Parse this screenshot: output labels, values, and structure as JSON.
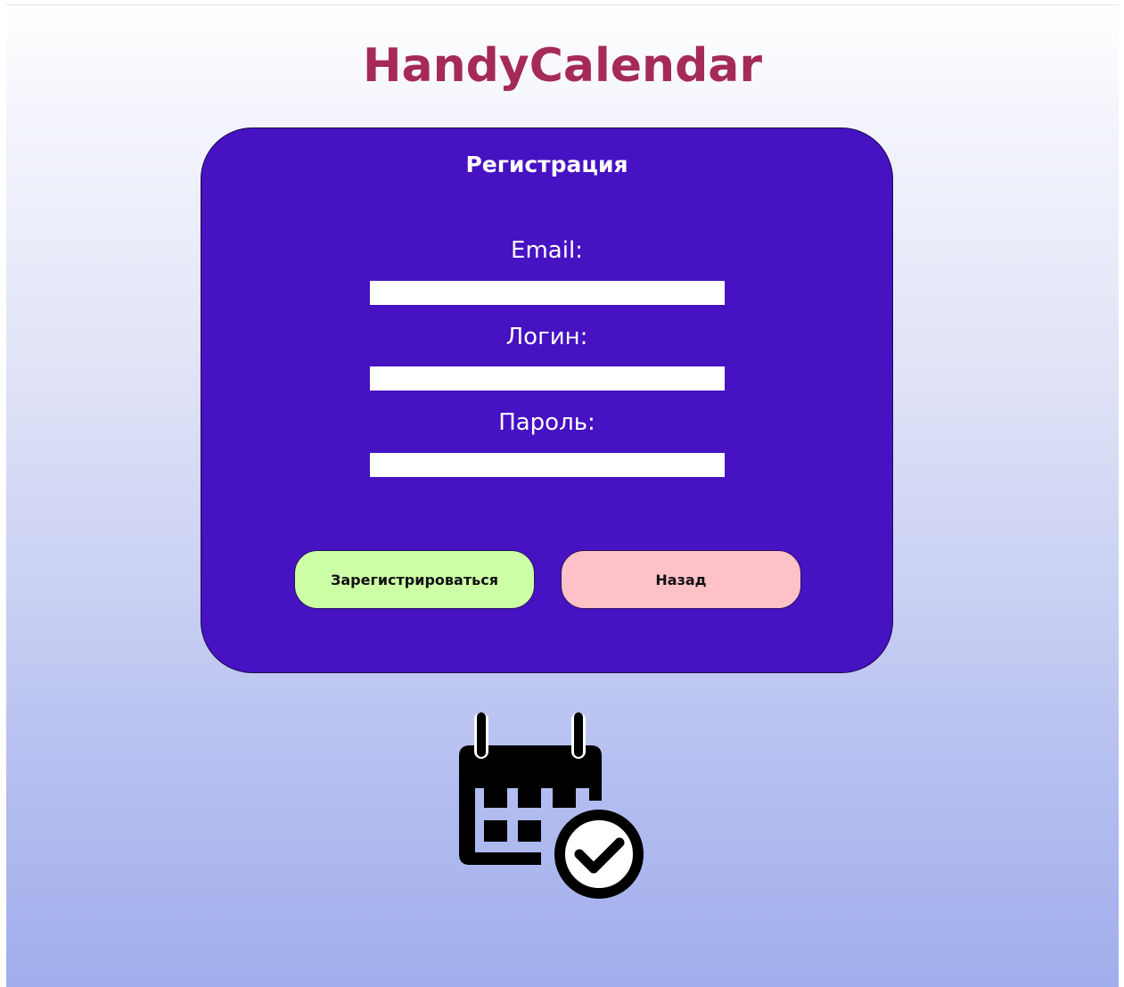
{
  "app": {
    "title": "HandyCalendar"
  },
  "form": {
    "title": "Регистрация",
    "fields": [
      {
        "label": "Email:",
        "value": "",
        "placeholder": ""
      },
      {
        "label": "Логин:",
        "value": "",
        "placeholder": ""
      },
      {
        "label": "Пароль:",
        "value": "",
        "placeholder": ""
      }
    ],
    "register_button": "Зарегистрироваться",
    "back_button": "Назад"
  },
  "illustration": {
    "icon": "calendar-check-icon"
  },
  "colors": {
    "title": "#a52a58",
    "card": "#4612c2",
    "register_button": "#cdffa6",
    "back_button": "#ffc1c8"
  }
}
